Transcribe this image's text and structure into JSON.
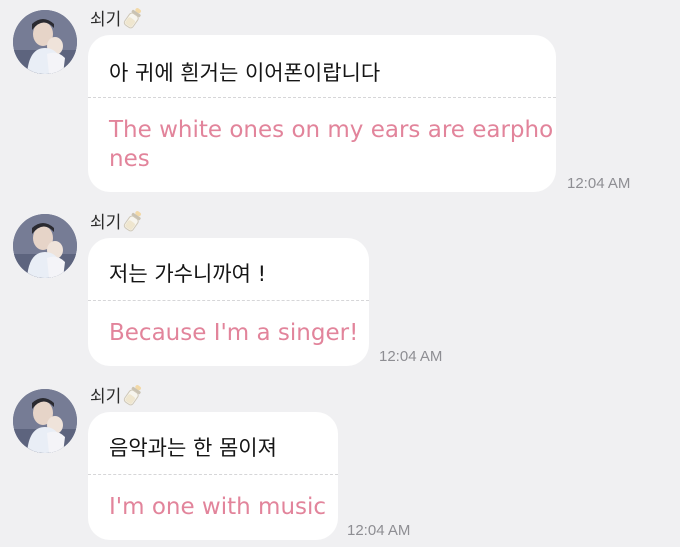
{
  "colors": {
    "background": "#f0f0f2",
    "bubble": "#ffffff",
    "translation_text": "#e2849b",
    "timestamp": "#8e8e93"
  },
  "messages": [
    {
      "sender": "쇠기",
      "sender_icon": "baby-bottle-icon",
      "original": "아 귀에 흰거는 이어폰이랍니다",
      "translation_line1": "The white ones on my ears are earpho",
      "translation_line2": "nes",
      "time": "12:04 AM"
    },
    {
      "sender": "쇠기",
      "sender_icon": "baby-bottle-icon",
      "original": "저는 가수니까여 !",
      "translation_line1": "Because I'm a singer!",
      "time": "12:04 AM"
    },
    {
      "sender": "쇠기",
      "sender_icon": "baby-bottle-icon",
      "original": "음악과는 한 몸이져",
      "translation_line1": "I'm one with music",
      "time": "12:04 AM"
    }
  ]
}
